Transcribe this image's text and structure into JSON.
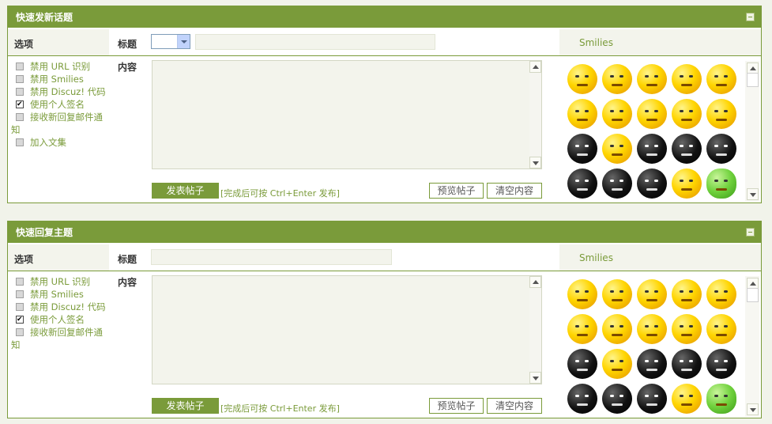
{
  "quick_post": {
    "header": "快速发新话题",
    "options_label": "选项",
    "title_label": "标题",
    "content_label": "内容",
    "smilies_label": "Smilies",
    "options": [
      {
        "label": "禁用 URL 识别",
        "checked": false
      },
      {
        "label": "禁用 Smilies",
        "checked": false
      },
      {
        "label": "禁用 Discuz! 代码",
        "checked": false
      },
      {
        "label": "使用个人签名",
        "checked": true
      },
      {
        "label": "接收新回复邮件通知",
        "checked": false
      },
      {
        "label": "加入文集",
        "checked": false
      }
    ],
    "title_value": "",
    "content_value": "",
    "submit_label": "发表帖子",
    "hint": "[完成后可按 Ctrl+Enter 发布]",
    "preview_label": "预览帖子",
    "clear_label": "清空内容"
  },
  "quick_reply": {
    "header": "快速回复主题",
    "options_label": "选项",
    "title_label": "标题",
    "content_label": "内容",
    "smilies_label": "Smilies",
    "options": [
      {
        "label": "禁用 URL 识别",
        "checked": false
      },
      {
        "label": "禁用 Smilies",
        "checked": false
      },
      {
        "label": "禁用 Discuz! 代码",
        "checked": false
      },
      {
        "label": "使用个人签名",
        "checked": true
      },
      {
        "label": "接收新回复邮件通知",
        "checked": false
      }
    ],
    "title_value": "",
    "content_value": "",
    "submit_label": "发表帖子",
    "hint": "[完成后可按 Ctrl+Enter 发布]",
    "preview_label": "预览帖子",
    "clear_label": "清空内容"
  },
  "smilies": [
    "yellow",
    "yellow",
    "yellow",
    "yellow",
    "yellow",
    "yellow",
    "yellow",
    "yellow",
    "yellow",
    "yellow",
    "black",
    "yellow",
    "black",
    "black",
    "black",
    "black",
    "black",
    "black",
    "yellow",
    "green"
  ],
  "colors": {
    "accent": "#7a9b3a",
    "panel_bg": "#f3f4ec"
  }
}
